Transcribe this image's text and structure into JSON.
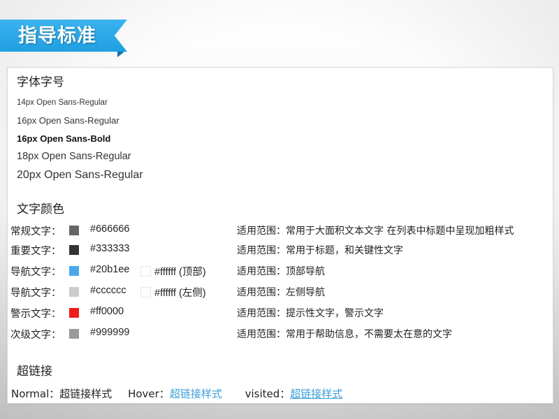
{
  "banner": {
    "title": "指导标准",
    "color": "#20a3e6"
  },
  "fonts": {
    "heading": "字体字号",
    "samples": [
      {
        "text": "14px Open Sans-Regular",
        "size": 14,
        "weight": "regular"
      },
      {
        "text": "16px Open Sans-Regular",
        "size": 16,
        "weight": "regular"
      },
      {
        "text": "16px Open Sans-Bold",
        "size": 16,
        "weight": "bold"
      },
      {
        "text": "18px Open Sans-Regular",
        "size": 18,
        "weight": "regular"
      },
      {
        "text": "20px Open Sans-Regular",
        "size": 20,
        "weight": "regular"
      }
    ]
  },
  "colors": {
    "heading": "文字颜色",
    "rows": [
      {
        "label": "常规文字：",
        "swatch": "#666666",
        "code": "#666666",
        "scope": "适用范围：常用于大面积文本文字 在列表中标题中呈现加粗样式"
      },
      {
        "label": "重要文字：",
        "swatch": "#333333",
        "code": "#333333",
        "scope": "适用范围：常用于标题，和关键性文字"
      },
      {
        "label": "导航文字：",
        "swatch": "#4aa8e8",
        "code": "#20b1ee",
        "swatch2": "#ffffff",
        "code2": "#ffffff (顶部)",
        "scope": "适用范围：顶部导航"
      },
      {
        "label": "导航文字：",
        "swatch": "#cccccc",
        "code": "#cccccc",
        "swatch2": "#ffffff",
        "code2": "#ffffff (左侧)",
        "scope": "适用范围：左侧导航"
      },
      {
        "label": "警示文字：",
        "swatch": "#ee1c1c",
        "code": "#ff0000",
        "scope": "适用范围：提示性文字，警示文字"
      },
      {
        "label": "次级文字：",
        "swatch": "#999999",
        "code": "#999999",
        "scope": "适用范围：常用于帮助信息，不需要太在意的文字"
      }
    ]
  },
  "links": {
    "heading": "超链接",
    "normal_label": "Normal：",
    "normal_value": "超链接样式",
    "hover_label": "Hover：",
    "hover_value": "超链接样式",
    "visited_label": "visited：",
    "visited_value": "超链接样式",
    "link_color": "#3c9ed8"
  }
}
